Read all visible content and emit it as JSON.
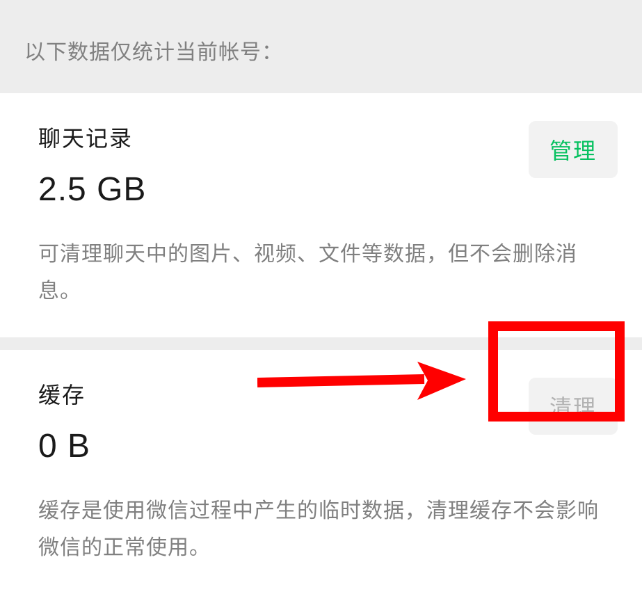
{
  "header": {
    "note": "以下数据仅统计当前帐号："
  },
  "sections": {
    "chat_history": {
      "title": "聊天记录",
      "value": "2.5 GB",
      "description": "可清理聊天中的图片、视频、文件等数据，但不会删除消息。",
      "button_label": "管理"
    },
    "cache": {
      "title": "缓存",
      "value": "0 B",
      "description": "缓存是使用微信过程中产生的临时数据，清理缓存不会影响微信的正常使用。",
      "button_label": "清理"
    }
  }
}
